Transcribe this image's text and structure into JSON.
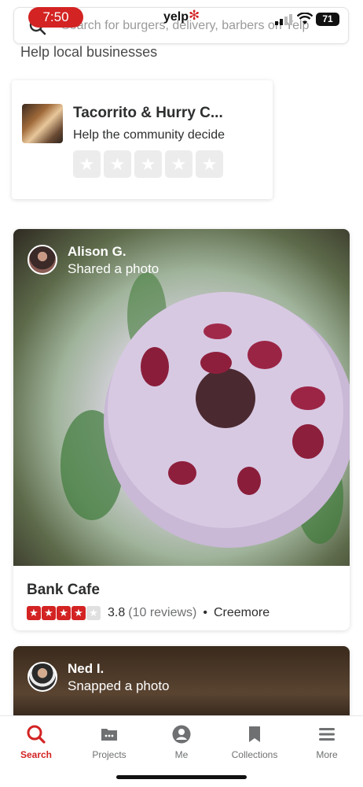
{
  "status_bar": {
    "time": "7:50",
    "battery": "71"
  },
  "header": {
    "logo": "yelp",
    "search_placeholder": "Search for burgers, delivery, barbers on Yelp"
  },
  "section": {
    "title": "Help local businesses"
  },
  "review_prompt": {
    "business": "Tacorrito & Hurry C...",
    "subtitle": "Help the community decide",
    "star_count": 5
  },
  "feed": [
    {
      "user": "Alison G.",
      "action": "Shared a photo",
      "business": "Bank Cafe",
      "rating": 3.8,
      "rating_value": "3.8",
      "reviews": "(10 reviews)",
      "separator": "•",
      "location": "Creemore"
    },
    {
      "user": "Ned I.",
      "action": "Snapped a photo"
    }
  ],
  "bottom_nav": [
    {
      "label": "Search",
      "icon": "search-icon",
      "active": true
    },
    {
      "label": "Projects",
      "icon": "projects-icon",
      "active": false
    },
    {
      "label": "Me",
      "icon": "profile-icon",
      "active": false
    },
    {
      "label": "Collections",
      "icon": "bookmark-icon",
      "active": false
    },
    {
      "label": "More",
      "icon": "menu-icon",
      "active": false
    }
  ],
  "colors": {
    "brand": "#d32323",
    "star_empty": "#e0e0e0"
  }
}
